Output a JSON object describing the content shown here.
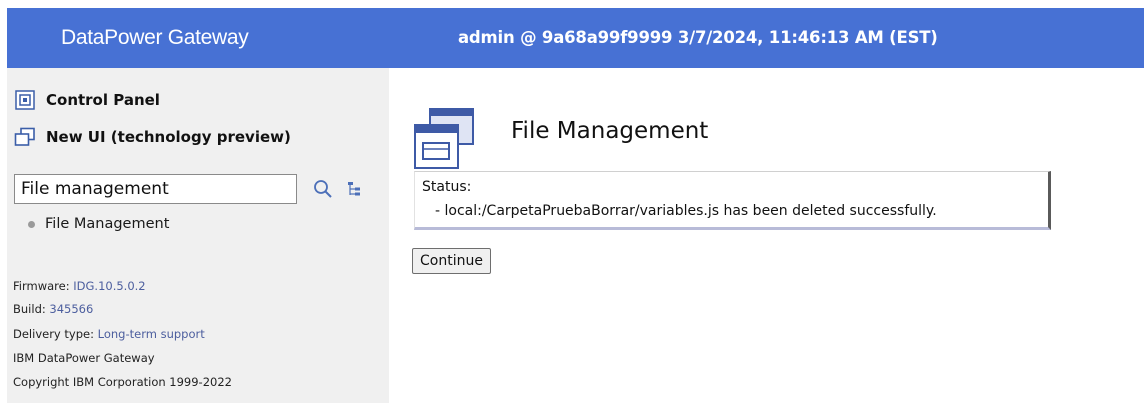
{
  "header": {
    "brand": "DataPower Gateway",
    "session": "admin @ 9a68a99f9999 3/7/2024, 11:46:13 AM (EST)",
    "background": "#4771d4"
  },
  "sidebar": {
    "control_panel": {
      "label": "Control Panel",
      "icon": "control-panel-icon"
    },
    "new_ui": {
      "label": "New UI (technology preview)",
      "icon": "external-window-icon"
    },
    "search": {
      "value": "File management",
      "search_icon": "search-icon",
      "tree_icon": "tree-icon"
    },
    "results": [
      {
        "label": "File Management"
      }
    ],
    "info": {
      "firmware_label": "Firmware:",
      "firmware_value": "IDG.10.5.0.2",
      "build_label": "Build:",
      "build_value": "345566",
      "delivery_label": "Delivery type:",
      "delivery_value": "Long-term support",
      "product": "IBM DataPower Gateway",
      "copyright": "Copyright IBM Corporation 1999-2022"
    }
  },
  "main": {
    "page_icon": "file-management-icon",
    "title": "File Management",
    "status_label": "Status:",
    "status_message": "- local:/CarpetaPruebaBorrar/variables.js has been deleted successfully.",
    "continue_label": "Continue"
  }
}
